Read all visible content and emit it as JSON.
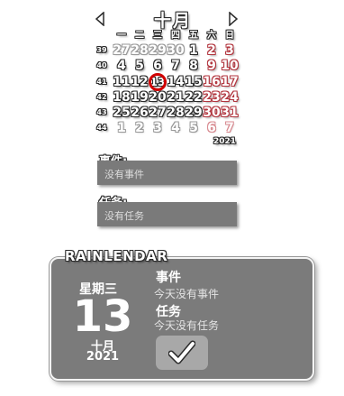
{
  "calendar": {
    "month_title": "十月",
    "year": "2021",
    "weekdays": [
      "一",
      "二",
      "三",
      "四",
      "五",
      "六",
      "日"
    ],
    "weeks": [
      {
        "week": "39",
        "days": [
          "27",
          "28",
          "29",
          "30",
          "1",
          "2",
          "3"
        ]
      },
      {
        "week": "40",
        "days": [
          "4",
          "5",
          "6",
          "7",
          "8",
          "9",
          "10"
        ]
      },
      {
        "week": "41",
        "days": [
          "11",
          "12",
          "13",
          "14",
          "15",
          "16",
          "17"
        ]
      },
      {
        "week": "42",
        "days": [
          "18",
          "19",
          "20",
          "21",
          "22",
          "23",
          "24"
        ]
      },
      {
        "week": "43",
        "days": [
          "25",
          "26",
          "27",
          "28",
          "29",
          "30",
          "31"
        ]
      },
      {
        "week": "44",
        "days": [
          "1",
          "2",
          "3",
          "4",
          "5",
          "6",
          "7"
        ]
      }
    ],
    "today": "13"
  },
  "events": {
    "label": "事件:",
    "empty_text": "没有事件"
  },
  "tasks": {
    "label": "任务:",
    "empty_text": "没有任务"
  },
  "rainlendar": {
    "logo": "RAINLENDAR",
    "day_name": "星期三",
    "day_number": "13",
    "month": "十月",
    "year": "2021",
    "events_heading": "事件",
    "events_text": "今天没有事件",
    "tasks_heading": "任务",
    "tasks_text": "今天没有任务",
    "check_icon": "checkmark-icon"
  },
  "colors": {
    "weekend_outline": "#b2363f",
    "today_ring": "#d00000",
    "panel_bg": "#7b7b7b"
  }
}
